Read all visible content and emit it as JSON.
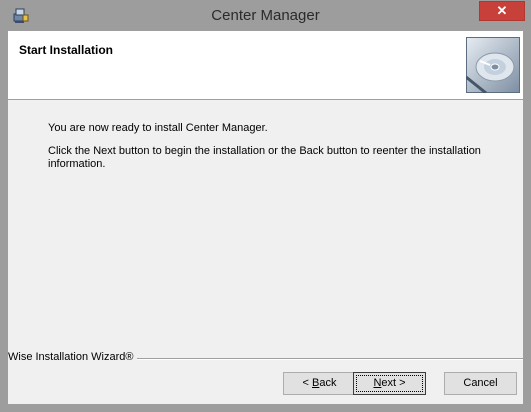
{
  "window": {
    "title": "Center Manager"
  },
  "header": {
    "title": "Start Installation"
  },
  "body": {
    "line1": "You are now ready to install Center Manager.",
    "line2": "Click the Next button to begin the installation or the Back button to reenter the installation information."
  },
  "footer": {
    "brand": "Wise Installation Wizard®",
    "back_prefix": "< ",
    "back_key": "B",
    "back_rest": "ack",
    "next_key": "N",
    "next_rest": "ext >",
    "cancel": "Cancel"
  },
  "icons": {
    "app": "installer-icon",
    "close": "close-icon",
    "header": "cd-disc-icon"
  },
  "colors": {
    "titlebar": "#9d9d9d",
    "close": "#c7413a",
    "dialog_bg": "#f0f0f0"
  }
}
